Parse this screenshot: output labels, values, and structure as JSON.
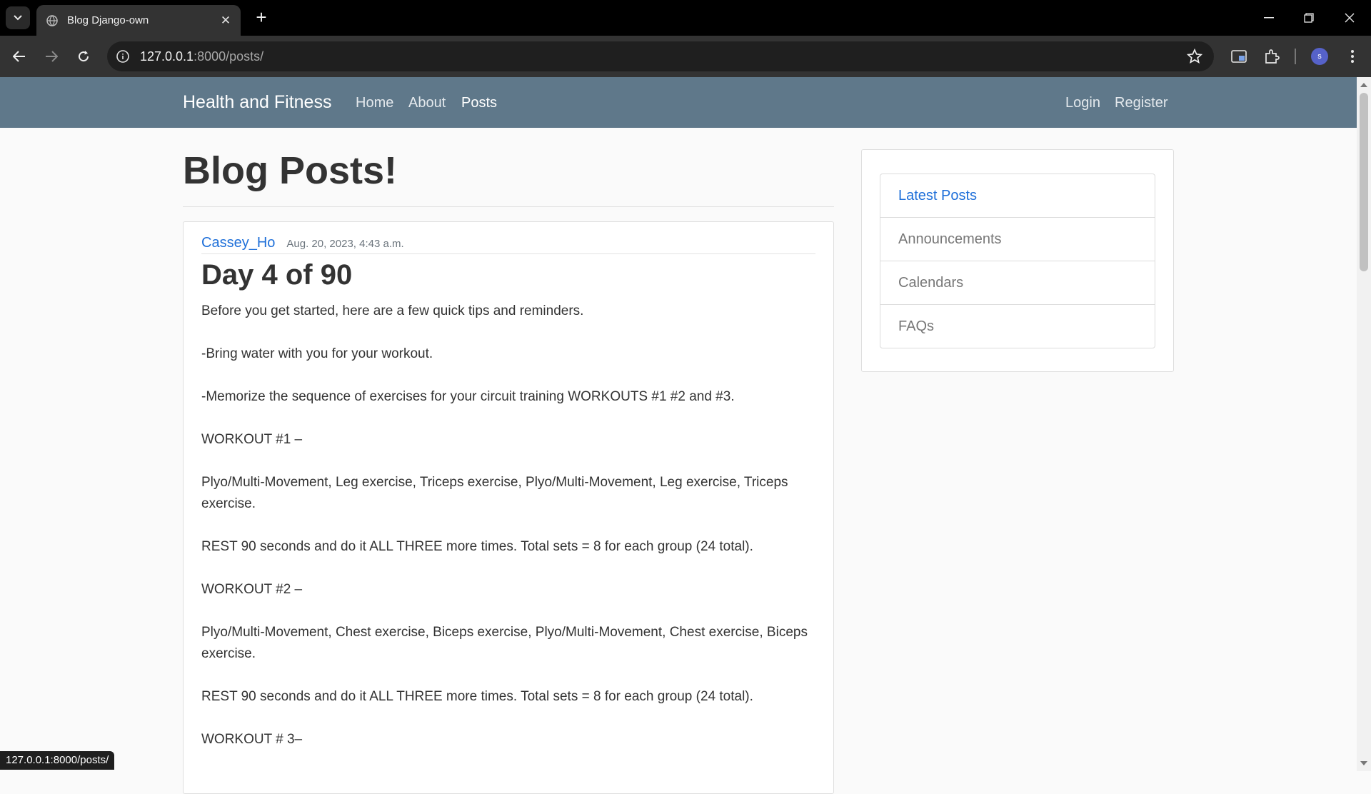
{
  "browser": {
    "tab_title": "Blog Django-own",
    "url_host": "127.0.0.1",
    "url_rest": ":8000/posts/",
    "profile_initial": "s",
    "status_url": "127.0.0.1:8000/posts/"
  },
  "site": {
    "brand": "Health and Fitness",
    "nav": [
      "Home",
      "About",
      "Posts"
    ],
    "auth": [
      "Login",
      "Register"
    ]
  },
  "page": {
    "title": "Blog Posts!"
  },
  "post": {
    "author": "Cassey_Ho",
    "date": "Aug. 20, 2023, 4:43 a.m.",
    "title": "Day 4 of 90",
    "paragraphs": [
      "Before you get started, here are a few quick tips and reminders.",
      "-Bring water with you for your workout.",
      "-Memorize the sequence of exercises for your circuit training WORKOUTS #1 #2 and #3.",
      "WORKOUT #1 –",
      "Plyo/Multi-Movement, Leg exercise, Triceps exercise, Plyo/Multi-Movement, Leg exercise, Triceps exercise.",
      "REST 90 seconds and do it ALL THREE more times. Total sets = 8 for each group (24 total).",
      "WORKOUT #2 –",
      "Plyo/Multi-Movement, Chest exercise, Biceps exercise, Plyo/Multi-Movement, Chest exercise, Biceps exercise.",
      "REST 90 seconds and do it ALL THREE more times. Total sets = 8 for each group (24 total).",
      "WORKOUT # 3–"
    ]
  },
  "sidebar": {
    "items": [
      "Latest Posts",
      "Announcements",
      "Calendars",
      "FAQs"
    ]
  },
  "colors": {
    "navbar": "#5f788a",
    "link": "#1e6fd9"
  }
}
